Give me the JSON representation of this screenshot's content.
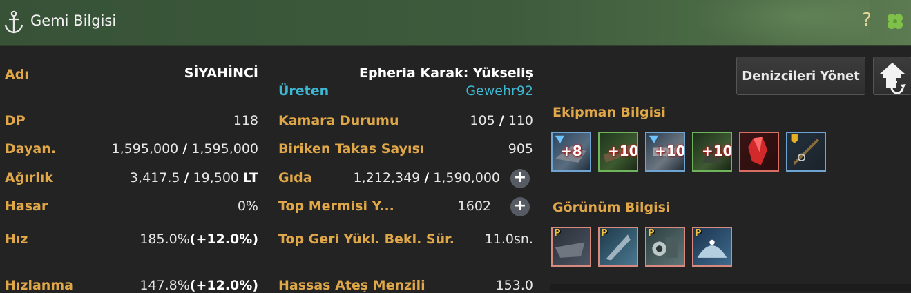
{
  "window": {
    "title": "Gemi Bilgisi",
    "help": "?"
  },
  "stats_left": [
    {
      "label": "Adı",
      "value": "SİYAHİNCİ"
    },
    {
      "label": "DP",
      "value": "118"
    },
    {
      "label": "Dayan.",
      "current": "1,595,000",
      "max": "1,595,000"
    },
    {
      "label": "Ağırlık",
      "current": "3,417.5",
      "max": "19,500",
      "unit": "LT"
    },
    {
      "label": "Hasar",
      "value": "0%"
    },
    {
      "label": "Hız",
      "value": "185.0%",
      "bonus": "(+12.0%)"
    },
    {
      "label": "Hızlanma",
      "value": "147.8%",
      "bonus": "(+12.0%)"
    }
  ],
  "ship": {
    "type": "Epheria Karak: Yükseliş",
    "maker_label": "Üreten",
    "maker": "Gewehr92"
  },
  "stats_mid": [
    {
      "label": "Kamara Durumu",
      "current": "105",
      "max": "110"
    },
    {
      "label": "Biriken Takas Sayısı",
      "value": "905"
    },
    {
      "label": "Gıda",
      "current": "1,212,349",
      "max": "1,590,000"
    },
    {
      "label": "Top Mermisi Y...",
      "value": "1602"
    },
    {
      "label": "Top Geri Yükl. Bekl. Sür.",
      "value": "11.0sn."
    },
    {
      "label": "Hassas Ateş Menzili",
      "value": "153.0"
    }
  ],
  "separator": "/",
  "plus": "+",
  "buttons": {
    "manage_sailors": "Denizcileri Yönet"
  },
  "equipment": {
    "title": "Ekipman Bilgisi",
    "items": [
      {
        "icon": "ship-prow-icon",
        "enhance": "+8",
        "grade": "blue"
      },
      {
        "icon": "ship-plating-icon",
        "enhance": "+10",
        "grade": "green"
      },
      {
        "icon": "ship-cannon-icon",
        "enhance": "+10",
        "grade": "blue"
      },
      {
        "icon": "ship-sail-icon",
        "enhance": "+10",
        "grade": "green"
      },
      {
        "icon": "red-crystal-icon",
        "enhance": "",
        "grade": "red"
      },
      {
        "icon": "fishing-rod-icon",
        "enhance": "",
        "grade": "blue"
      }
    ]
  },
  "appearance": {
    "title": "Görünüm Bilgisi",
    "mark": "P",
    "items": [
      {
        "icon": "ship-hull-skin-icon"
      },
      {
        "icon": "figurehead-skin-icon"
      },
      {
        "icon": "cannon-skin-icon"
      },
      {
        "icon": "sail-skin-icon"
      }
    ]
  },
  "colors": {
    "label": "#e0a748",
    "accent": "#3db7d2",
    "titlebar": "#3e5b3c"
  }
}
